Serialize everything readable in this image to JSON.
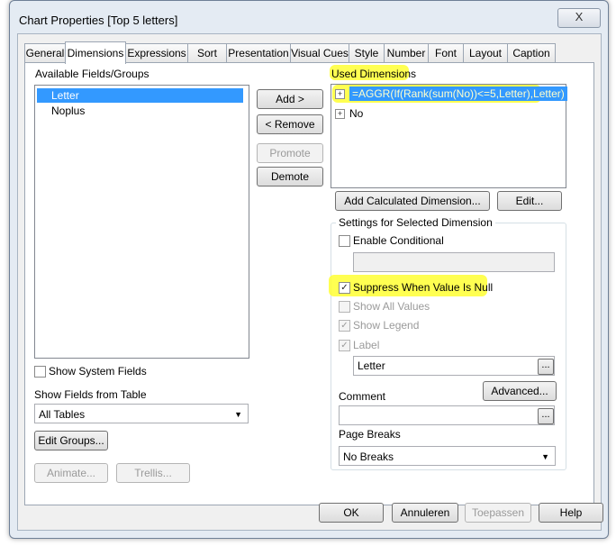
{
  "window": {
    "title": "Chart Properties [Top 5 letters]",
    "close_label": "X"
  },
  "tabs": [
    "General",
    "Dimensions",
    "Expressions",
    "Sort",
    "Presentation",
    "Visual Cues",
    "Style",
    "Number",
    "Font",
    "Layout",
    "Caption"
  ],
  "available": {
    "header": "Available Fields/Groups",
    "items": [
      "Letter",
      "Noplus"
    ],
    "show_system_fields": "Show System Fields",
    "show_fields_from_table": "Show Fields from Table",
    "table_select": "All Tables",
    "edit_groups": "Edit Groups...",
    "animate": "Animate...",
    "trellis": "Trellis..."
  },
  "middle_buttons": {
    "add": "Add >",
    "remove": "< Remove",
    "promote": "Promote",
    "demote": "Demote"
  },
  "used": {
    "header": "Used Dimensions",
    "items": [
      "=AGGR(If(Rank(sum(No))<=5,Letter),Letter)",
      "No"
    ],
    "expander": "+",
    "add_calculated": "Add Calculated Dimension...",
    "edit": "Edit..."
  },
  "settings": {
    "title": "Settings for Selected Dimension",
    "enable_conditional": "Enable Conditional",
    "suppress_null": "Suppress When Value Is Null",
    "show_all_values": "Show All Values",
    "show_legend": "Show Legend",
    "label": "Label",
    "label_value": "Letter",
    "ellipsis": "...",
    "advanced": "Advanced...",
    "comment": "Comment",
    "comment_value": "",
    "page_breaks": "Page Breaks",
    "page_breaks_value": "No Breaks",
    "check": "✓"
  },
  "footer": {
    "ok": "OK",
    "cancel": "Annuleren",
    "apply": "Toepassen",
    "help": "Help"
  },
  "colors": {
    "highlight": "#ffff33",
    "selection": "#3399ff"
  }
}
